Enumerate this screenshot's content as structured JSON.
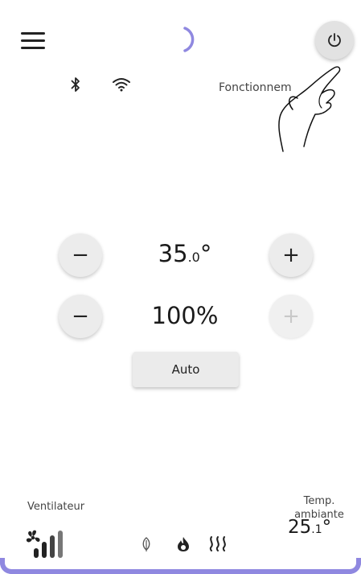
{
  "header": {
    "menu_icon": "hamburger-menu-icon",
    "loading_icon": "spinner-icon",
    "power_icon": "power-icon"
  },
  "status": {
    "bluetooth_icon": "bluetooth-icon",
    "wifi_icon": "wifi-icon",
    "state_text": "Fonctionnement"
  },
  "controls": {
    "temperature": {
      "main": "35",
      "decimal": ".0",
      "unit": "°",
      "minus": "−",
      "plus": "+"
    },
    "fan_speed": {
      "value": "100%",
      "minus": "−",
      "plus": "+",
      "plus_enabled": false
    },
    "auto_label": "Auto"
  },
  "footer": {
    "fan_label": "Ventilateur",
    "fan_icon": "fan-level-icon",
    "mode_icons": [
      "leaf-icon",
      "flame-icon",
      "heat-waves-icon"
    ],
    "ambient_label_line1": "Temp.",
    "ambient_label_line2": "ambiante",
    "ambient_main": "25",
    "ambient_decimal": ".1",
    "ambient_unit": "°"
  },
  "colors": {
    "accent": "#8f88e0",
    "button_bg": "#ececec"
  }
}
